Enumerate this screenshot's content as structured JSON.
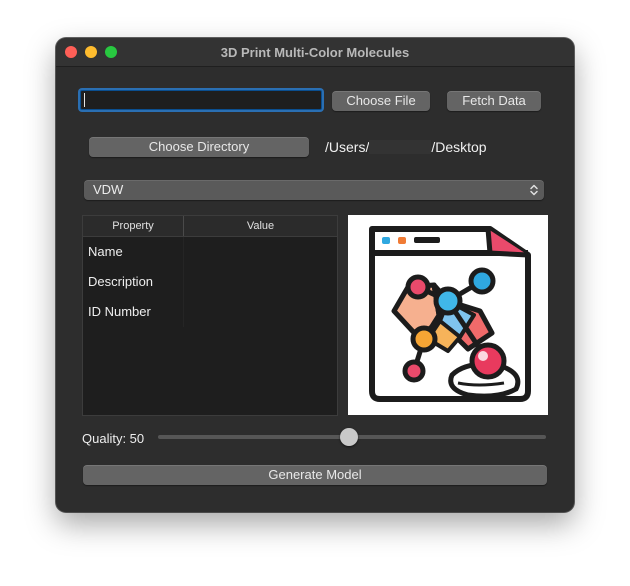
{
  "window": {
    "title": "3D Print Multi-Color Molecules"
  },
  "file_input": {
    "value": ""
  },
  "buttons": {
    "choose_file": "Choose File",
    "fetch_data": "Fetch Data",
    "choose_directory": "Choose Directory",
    "generate_model": "Generate Model"
  },
  "directory": {
    "path_prefix": "/Users/",
    "path_suffix": "/Desktop"
  },
  "representation_select": {
    "selected": "VDW"
  },
  "properties_table": {
    "headers": [
      "Property",
      "Value"
    ],
    "rows": [
      {
        "property": "Name",
        "value": ""
      },
      {
        "property": "Description",
        "value": ""
      },
      {
        "property": "ID Number",
        "value": ""
      }
    ]
  },
  "preview_image": {
    "icon": "molecule-app-icon"
  },
  "quality": {
    "label": "Quality: 50",
    "value": 50,
    "min": 0,
    "max": 100
  },
  "colors": {
    "window_bg": "#2d2d2d",
    "button_bg": "#646464",
    "focus_ring": "#2a6fb3",
    "traffic_close": "#fe5f57",
    "traffic_minimize": "#febc2e",
    "traffic_maximize": "#28c840"
  }
}
